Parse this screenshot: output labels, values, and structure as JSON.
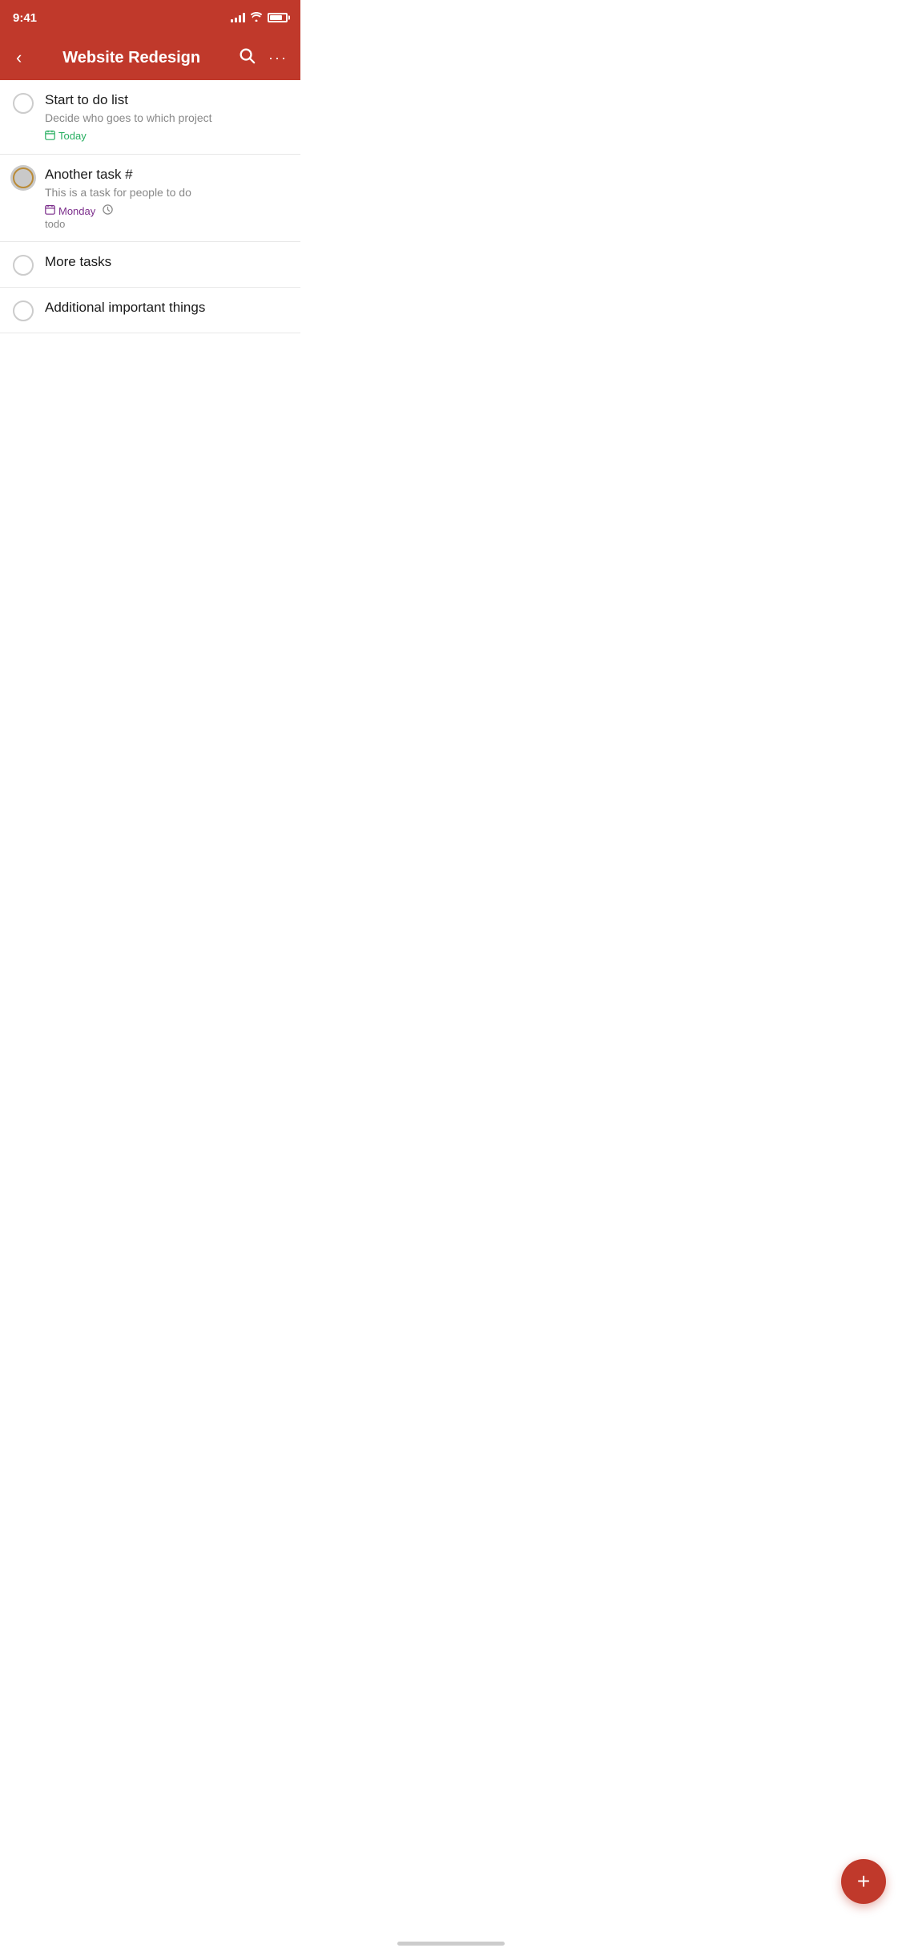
{
  "statusBar": {
    "time": "9:41"
  },
  "navBar": {
    "title": "Website Redesign",
    "backLabel": "‹",
    "searchLabel": "⌕",
    "moreLabel": "···"
  },
  "tasks": [
    {
      "id": 1,
      "title": "Start to do list",
      "description": "Decide who goes to which project",
      "dateLabel": "Today",
      "dateColor": "green",
      "dateIcon": "▤",
      "hasReminder": false,
      "label": "",
      "checkboxState": "default"
    },
    {
      "id": 2,
      "title": "Another task #",
      "description": "This is a task for people to do",
      "dateLabel": "Monday",
      "dateColor": "purple",
      "dateIcon": "▤",
      "hasReminder": true,
      "label": "todo",
      "checkboxState": "orange"
    },
    {
      "id": 3,
      "title": "More tasks",
      "description": "",
      "dateLabel": "",
      "dateColor": "",
      "dateIcon": "",
      "hasReminder": false,
      "label": "",
      "checkboxState": "default"
    },
    {
      "id": 4,
      "title": "Additional important things",
      "description": "",
      "dateLabel": "",
      "dateColor": "",
      "dateIcon": "",
      "hasReminder": false,
      "label": "",
      "checkboxState": "default"
    }
  ],
  "fab": {
    "label": "+"
  }
}
